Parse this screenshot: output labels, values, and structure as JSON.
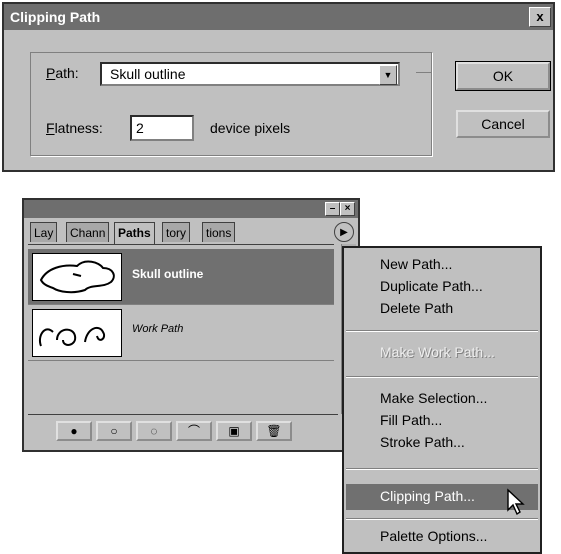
{
  "dialog": {
    "title": "Clipping Path",
    "close_glyph": "x",
    "path_label_hotkey": "P",
    "path_label_rest": "ath:",
    "path_value": "Skull outline",
    "flatness_label_hotkey": "F",
    "flatness_label_rest": "latness:",
    "flatness_value": "2",
    "flatness_unit": "device pixels",
    "ok_label": "OK",
    "cancel_label": "Cancel"
  },
  "palette": {
    "tabs": [
      "Lay",
      "Chann",
      "Paths",
      "tory",
      "tions"
    ],
    "active_tab": "Paths",
    "paths": [
      {
        "name": "Skull outline",
        "selected": true
      },
      {
        "name": "Work Path",
        "selected": false
      }
    ],
    "footer_icons": [
      "fill-path-icon",
      "stroke-path-icon",
      "load-selection-icon",
      "make-work-path-icon",
      "new-path-icon",
      "trash-icon"
    ]
  },
  "menu": {
    "items": [
      {
        "label": "New Path...",
        "enabled": true
      },
      {
        "label": "Duplicate Path...",
        "enabled": true
      },
      {
        "label": "Delete Path",
        "enabled": true
      },
      {
        "label": "Make Work Path...",
        "enabled": false
      },
      {
        "label": "Make Selection...",
        "enabled": true
      },
      {
        "label": "Fill Path...",
        "enabled": true
      },
      {
        "label": "Stroke Path...",
        "enabled": true
      },
      {
        "label": "Clipping Path...",
        "enabled": true,
        "highlighted": true
      },
      {
        "label": "Palette Options...",
        "enabled": true
      }
    ]
  },
  "colors": {
    "window_face": "#c0c0c0",
    "title_bar": "#6e6e6e",
    "selection": "#707070"
  }
}
